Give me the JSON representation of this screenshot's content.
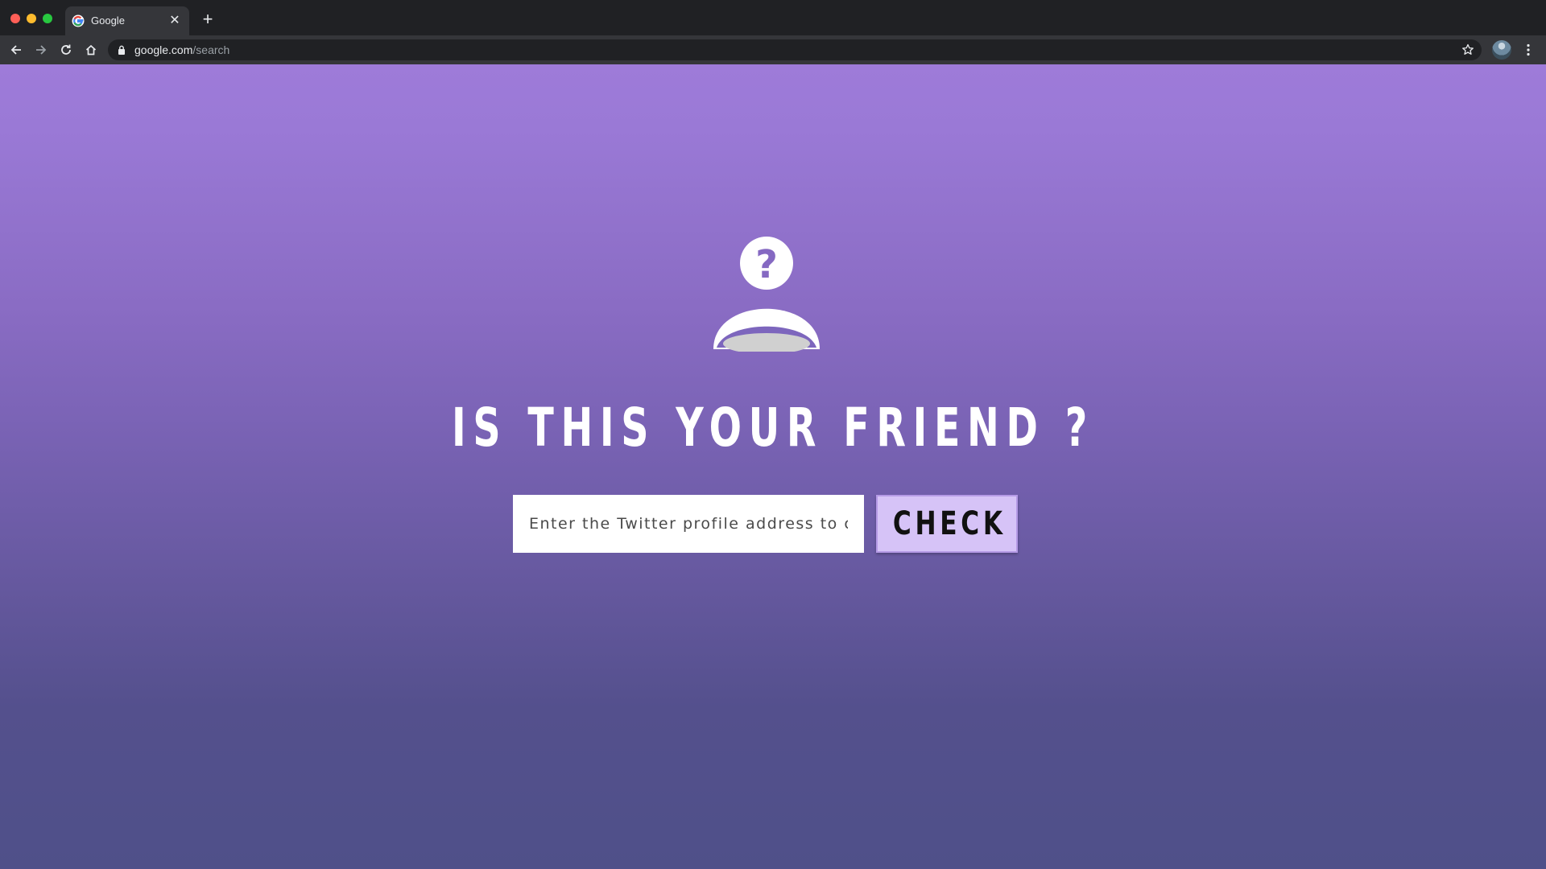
{
  "browser": {
    "tab": {
      "title": "Google",
      "favicon": "google-icon",
      "close_glyph": "✕"
    },
    "new_tab_glyph": "+",
    "address_bar": {
      "host": "google.com",
      "path": "/search",
      "lock_icon": "lock-icon"
    },
    "toolbar_icons": [
      "back-icon",
      "forward-icon",
      "reload-icon",
      "home-icon",
      "star-icon",
      "profile-avatar",
      "menu-icon"
    ]
  },
  "page": {
    "icon": "unknown-person-icon",
    "headline": "IS THIS YOUR FRIEND ?",
    "input_placeholder": "Enter the Twitter profile address to check",
    "input_value": "",
    "button_label": "CHECK",
    "colors": {
      "gradient_top": "#9e7bd9",
      "gradient_bottom": "#4f5089",
      "button_bg": "#d6c3f7",
      "text": "#ffffff"
    }
  }
}
